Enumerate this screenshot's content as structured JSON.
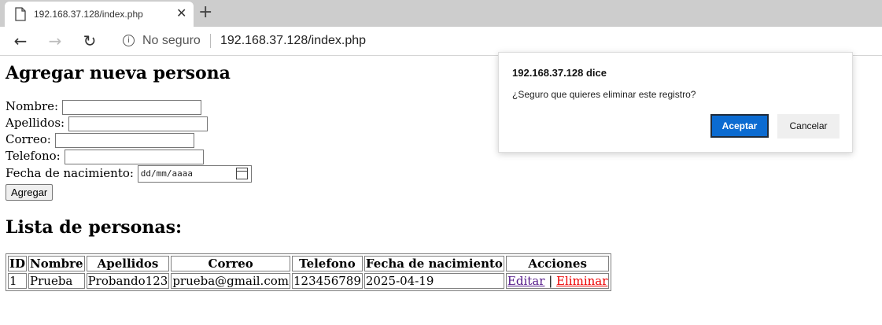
{
  "browser": {
    "tab_title": "192.168.37.128/index.php",
    "new_tab": "+",
    "close_tab": "✕",
    "security_label": "No seguro",
    "url": "192.168.37.128/index.php"
  },
  "form": {
    "heading": "Agregar nueva persona",
    "fields": [
      {
        "label": "Nombre:",
        "value": ""
      },
      {
        "label": "Apellidos:",
        "value": ""
      },
      {
        "label": "Correo:",
        "value": ""
      },
      {
        "label": "Telefono:",
        "value": ""
      }
    ],
    "date_label": "Fecha de nacimiento:",
    "date_placeholder": "dd/mm/aaaa",
    "submit_label": "Agregar"
  },
  "list": {
    "heading": "Lista de personas:",
    "columns": [
      "ID",
      "Nombre",
      "Apellidos",
      "Correo",
      "Telefono",
      "Fecha de nacimiento",
      "Acciones"
    ],
    "rows": [
      {
        "id": "1",
        "nombre": "Prueba",
        "apellidos": "Probando123",
        "correo": "prueba@gmail.com",
        "telefono": "123456789",
        "fecha": "2025-04-19",
        "edit": "Editar",
        "sep": "|",
        "delete": "Eliminar"
      }
    ]
  },
  "dialog": {
    "title": "192.168.37.128 dice",
    "message": "¿Seguro que quieres eliminar este registro?",
    "ok_label": "Aceptar",
    "cancel_label": "Cancelar"
  }
}
